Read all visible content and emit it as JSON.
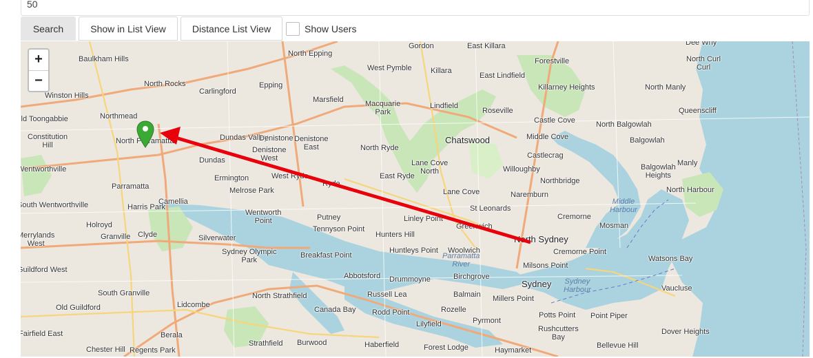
{
  "search_field": {
    "value": "50"
  },
  "toolbar": {
    "search_label": "Search",
    "list_view_label": "Show in List View",
    "distance_list_label": "Distance List View",
    "show_users_label": "Show Users"
  },
  "map": {
    "zoom_in_label": "+",
    "zoom_out_label": "−",
    "colors": {
      "water": "#aad3df",
      "land": "#ece7df",
      "park": "#c8e6b8",
      "marker": "#3aaa35",
      "arrow": "#e8000b"
    },
    "places": [
      "Dee Why",
      "Gordon",
      "East Killara",
      "North Epping",
      "North Curl Curl",
      "Baulkham Hills",
      "Forestville",
      "West Pymble",
      "Killara",
      "East Lindfield",
      "Killarney Heights",
      "North Manly",
      "North Rocks",
      "Epping",
      "Carlingford",
      "Winston Hills",
      "Marsfield",
      "Macquarie Park",
      "Lindfield",
      "Roseville",
      "Queenscliff",
      "Northmead",
      "Old Toongabbie",
      "Castle Cove",
      "North Balgowlah",
      "Constitution Hill",
      "North Parramatta",
      "Dundas Valley",
      "Denistone",
      "Denistone West",
      "Denistone East",
      "North Ryde",
      "Chatswood",
      "Middle Cove",
      "Balgowlah",
      "Castlecrag",
      "Dundas",
      "Lane Cove North",
      "Willoughby",
      "Manly",
      "Wentworthville",
      "Balgowlah Heights",
      "Ermington",
      "West Ryde",
      "Ryde",
      "East Ryde",
      "Northbridge",
      "Parramatta",
      "Melrose Park",
      "Lane Cove",
      "Naremburn",
      "North Harbour",
      "Camellia",
      "South Wentworthville",
      "Harris Park",
      "St Leonards",
      "Middle Harbour",
      "Wentworth Point",
      "Putney",
      "Linley Point",
      "Cremorne",
      "Mosman",
      "Holroyd",
      "Tennyson Point",
      "Greenwich",
      "Merrylands West",
      "Granville",
      "Clyde",
      "Silverwater",
      "Hunters Hill",
      "North Sydney",
      "Huntleys Point",
      "Woolwich",
      "Cremorne Point",
      "Sydney Olympic Park",
      "Breakfast Point",
      "Parramatta River",
      "Milsons Point",
      "Watsons Bay",
      "Guildford West",
      "Abbotsford",
      "Drummoyne",
      "Birchgrove",
      "Sydney",
      "Sydney Harbour",
      "Vaucluse",
      "South Granville",
      "North Strathfield",
      "Russell Lea",
      "Balmain",
      "Millers Point",
      "Old Guildford",
      "Lidcombe",
      "Canada Bay",
      "Rodd Point",
      "Rozelle",
      "Potts Point",
      "Point Piper",
      "Lilyfield",
      "Pyrmont",
      "Rushcutters Bay",
      "Fairfield East",
      "Berala",
      "Strathfield",
      "Burwood",
      "Haberfield",
      "Dover Heights",
      "Bellevue Hill",
      "Chester Hill",
      "Regents Park",
      "Forest Lodge",
      "Haymarket"
    ]
  }
}
